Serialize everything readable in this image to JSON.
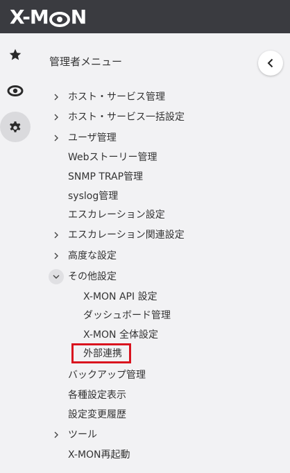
{
  "app": {
    "logo_text_left": "X-M",
    "logo_text_right": "N"
  },
  "colors": {
    "topbar": "#3a3b40",
    "highlight": "#d9131e",
    "background": "#f2f2f4"
  },
  "rail": {
    "items": [
      {
        "icon": "star-icon"
      },
      {
        "icon": "eye-icon"
      },
      {
        "icon": "gear-icon",
        "active": true
      }
    ]
  },
  "menu": {
    "title": "管理者メニュー",
    "items": [
      {
        "label": "ホスト・サービス管理",
        "expandable": true
      },
      {
        "label": "ホスト・サービス一括設定",
        "expandable": true
      },
      {
        "label": "ユーザ管理",
        "expandable": true
      },
      {
        "label": "Webストーリー管理"
      },
      {
        "label": "SNMP TRAP管理"
      },
      {
        "label": "syslog管理"
      },
      {
        "label": "エスカレーション設定"
      },
      {
        "label": "エスカレーション関連設定",
        "expandable": true
      },
      {
        "label": "高度な設定",
        "expandable": true
      },
      {
        "label": "その他設定",
        "expandable": true,
        "expanded": true
      },
      {
        "label": "X-MON API 設定",
        "sub": true
      },
      {
        "label": "ダッシュボード管理",
        "sub": true
      },
      {
        "label": "X-MON 全体設定",
        "sub": true
      },
      {
        "label": "外部連携",
        "sub": true,
        "highlighted": true
      },
      {
        "label": "バックアップ管理"
      },
      {
        "label": "各種設定表示"
      },
      {
        "label": "設定変更履歴"
      },
      {
        "label": "ツール",
        "expandable": true
      },
      {
        "label": "X-MON再起動"
      }
    ]
  }
}
